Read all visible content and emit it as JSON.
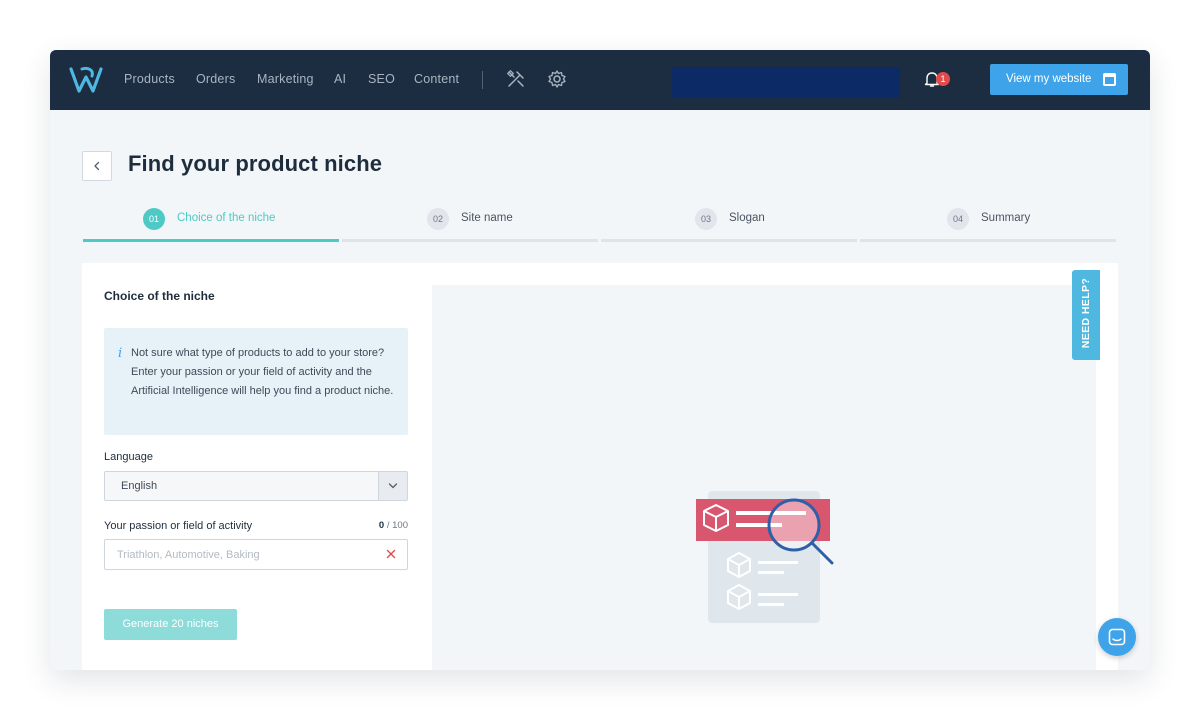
{
  "nav": {
    "items": [
      "Products",
      "Orders",
      "Marketing",
      "AI",
      "SEO",
      "Content"
    ],
    "notification_count": "1",
    "view_website_label": "View my website"
  },
  "page": {
    "title": "Find your product niche"
  },
  "steps": [
    {
      "num": "01",
      "label": "Choice of the niche",
      "active": true
    },
    {
      "num": "02",
      "label": "Site name",
      "active": false
    },
    {
      "num": "03",
      "label": "Slogan",
      "active": false
    },
    {
      "num": "04",
      "label": "Summary",
      "active": false
    }
  ],
  "form": {
    "title": "Choice of the niche",
    "info_icon": "i",
    "info_text": "Not sure what type of products to add to your store? Enter your passion or your field of activity and the Artificial Intelligence will help you find a product niche.",
    "language_label": "Language",
    "language_value": "English",
    "passion_label": "Your passion or field of activity",
    "count_current": "0",
    "count_max": "/ 100",
    "passion_placeholder": "Triathlon, Automotive, Baking",
    "passion_value": "",
    "generate_label": "Generate 20 niches"
  },
  "help": {
    "tab_label": "NEED HELP?"
  },
  "colors": {
    "nav_bg": "#1c2d42",
    "accent_teal": "#4ec9c6",
    "accent_blue": "#3ea3e8",
    "badge_red": "#e04b4b",
    "illustration_red": "#d9566f"
  }
}
